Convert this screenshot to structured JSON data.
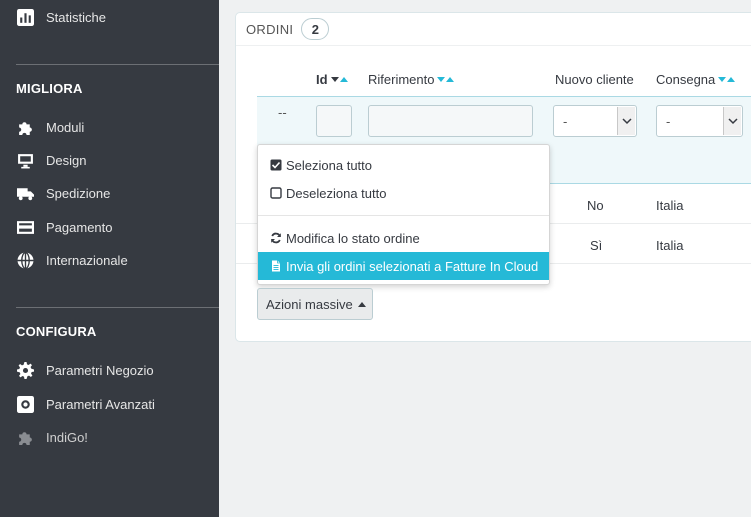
{
  "sidebar": {
    "top_item": {
      "label": "Statistiche",
      "icon": "bar-chart-icon"
    },
    "sections": [
      {
        "heading": "MIGLIORA",
        "items": [
          {
            "label": "Moduli",
            "icon": "puzzle-icon"
          },
          {
            "label": "Design",
            "icon": "monitor-icon"
          },
          {
            "label": "Spedizione",
            "icon": "truck-icon"
          },
          {
            "label": "Pagamento",
            "icon": "credit-card-icon"
          },
          {
            "label": "Internazionale",
            "icon": "globe-icon"
          }
        ]
      },
      {
        "heading": "CONFIGURA",
        "items": [
          {
            "label": "Parametri Negozio",
            "icon": "gear-icon"
          },
          {
            "label": "Parametri Avanzati",
            "icon": "cog-box-icon"
          },
          {
            "label": "IndiGo!",
            "icon": "puzzle-icon"
          }
        ]
      }
    ]
  },
  "panel": {
    "title": "ORDINI",
    "count": "2",
    "columns": [
      {
        "label": "Id",
        "bold": true
      },
      {
        "label": "Riferimento"
      },
      {
        "label": "Nuovo cliente"
      },
      {
        "label": "Consegna"
      }
    ],
    "filters": {
      "bulk_placeholder": "--",
      "nuovo_cliente_value": "-",
      "consegna_value": "-"
    },
    "rows": [
      {
        "nuovo_cliente": "No",
        "consegna": "Italia"
      },
      {
        "nuovo_cliente": "Sì",
        "consegna": "Italia"
      }
    ]
  },
  "bulk_menu": {
    "items": [
      {
        "label": "Seleziona tutto",
        "icon": "checkbox-checked-icon"
      },
      {
        "label": "Deseleziona tutto",
        "icon": "checkbox-empty-icon"
      },
      {
        "label": "Modifica lo stato ordine",
        "icon": "refresh-icon"
      },
      {
        "label": "Invia gli ordini selezionati a Fatture In Cloud",
        "icon": "document-icon",
        "active": true
      }
    ],
    "button_label": "Azioni massive"
  },
  "colors": {
    "accent": "#25b9d7",
    "sidebar_bg": "#363a41",
    "page_bg": "#eff1f2"
  }
}
